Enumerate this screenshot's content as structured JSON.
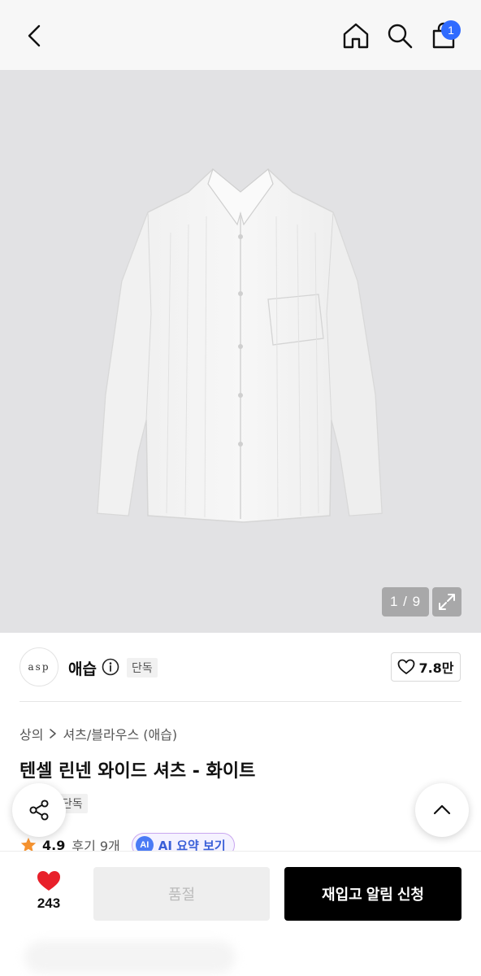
{
  "header": {
    "cart_badge": "1"
  },
  "gallery": {
    "counter": "1 / 9",
    "background_color": "#e2e2e4"
  },
  "brand": {
    "logo_text": "asp",
    "name": "애습",
    "exclusive_tag": "단독",
    "likes": "7.8만"
  },
  "breadcrumb": {
    "category": "상의",
    "subcategory": "셔츠/블라우스 (애습)"
  },
  "product": {
    "title": "텐셀 린넨 와이드 셔츠 - 화이트",
    "sub_tag": "단독"
  },
  "rating": {
    "value": "4.9",
    "reviews": "후기 9개",
    "ai_badge": "AI",
    "ai_label": "AI 요약 보기"
  },
  "bottom_bar": {
    "wish_count": "243",
    "soldout_label": "품절",
    "restock_label": "재입고 알림 신청"
  },
  "colors": {
    "accent_blue": "#2f6bff",
    "heart_red": "#e8202a",
    "star_orange": "#f5922f",
    "primary_button": "#000000"
  }
}
